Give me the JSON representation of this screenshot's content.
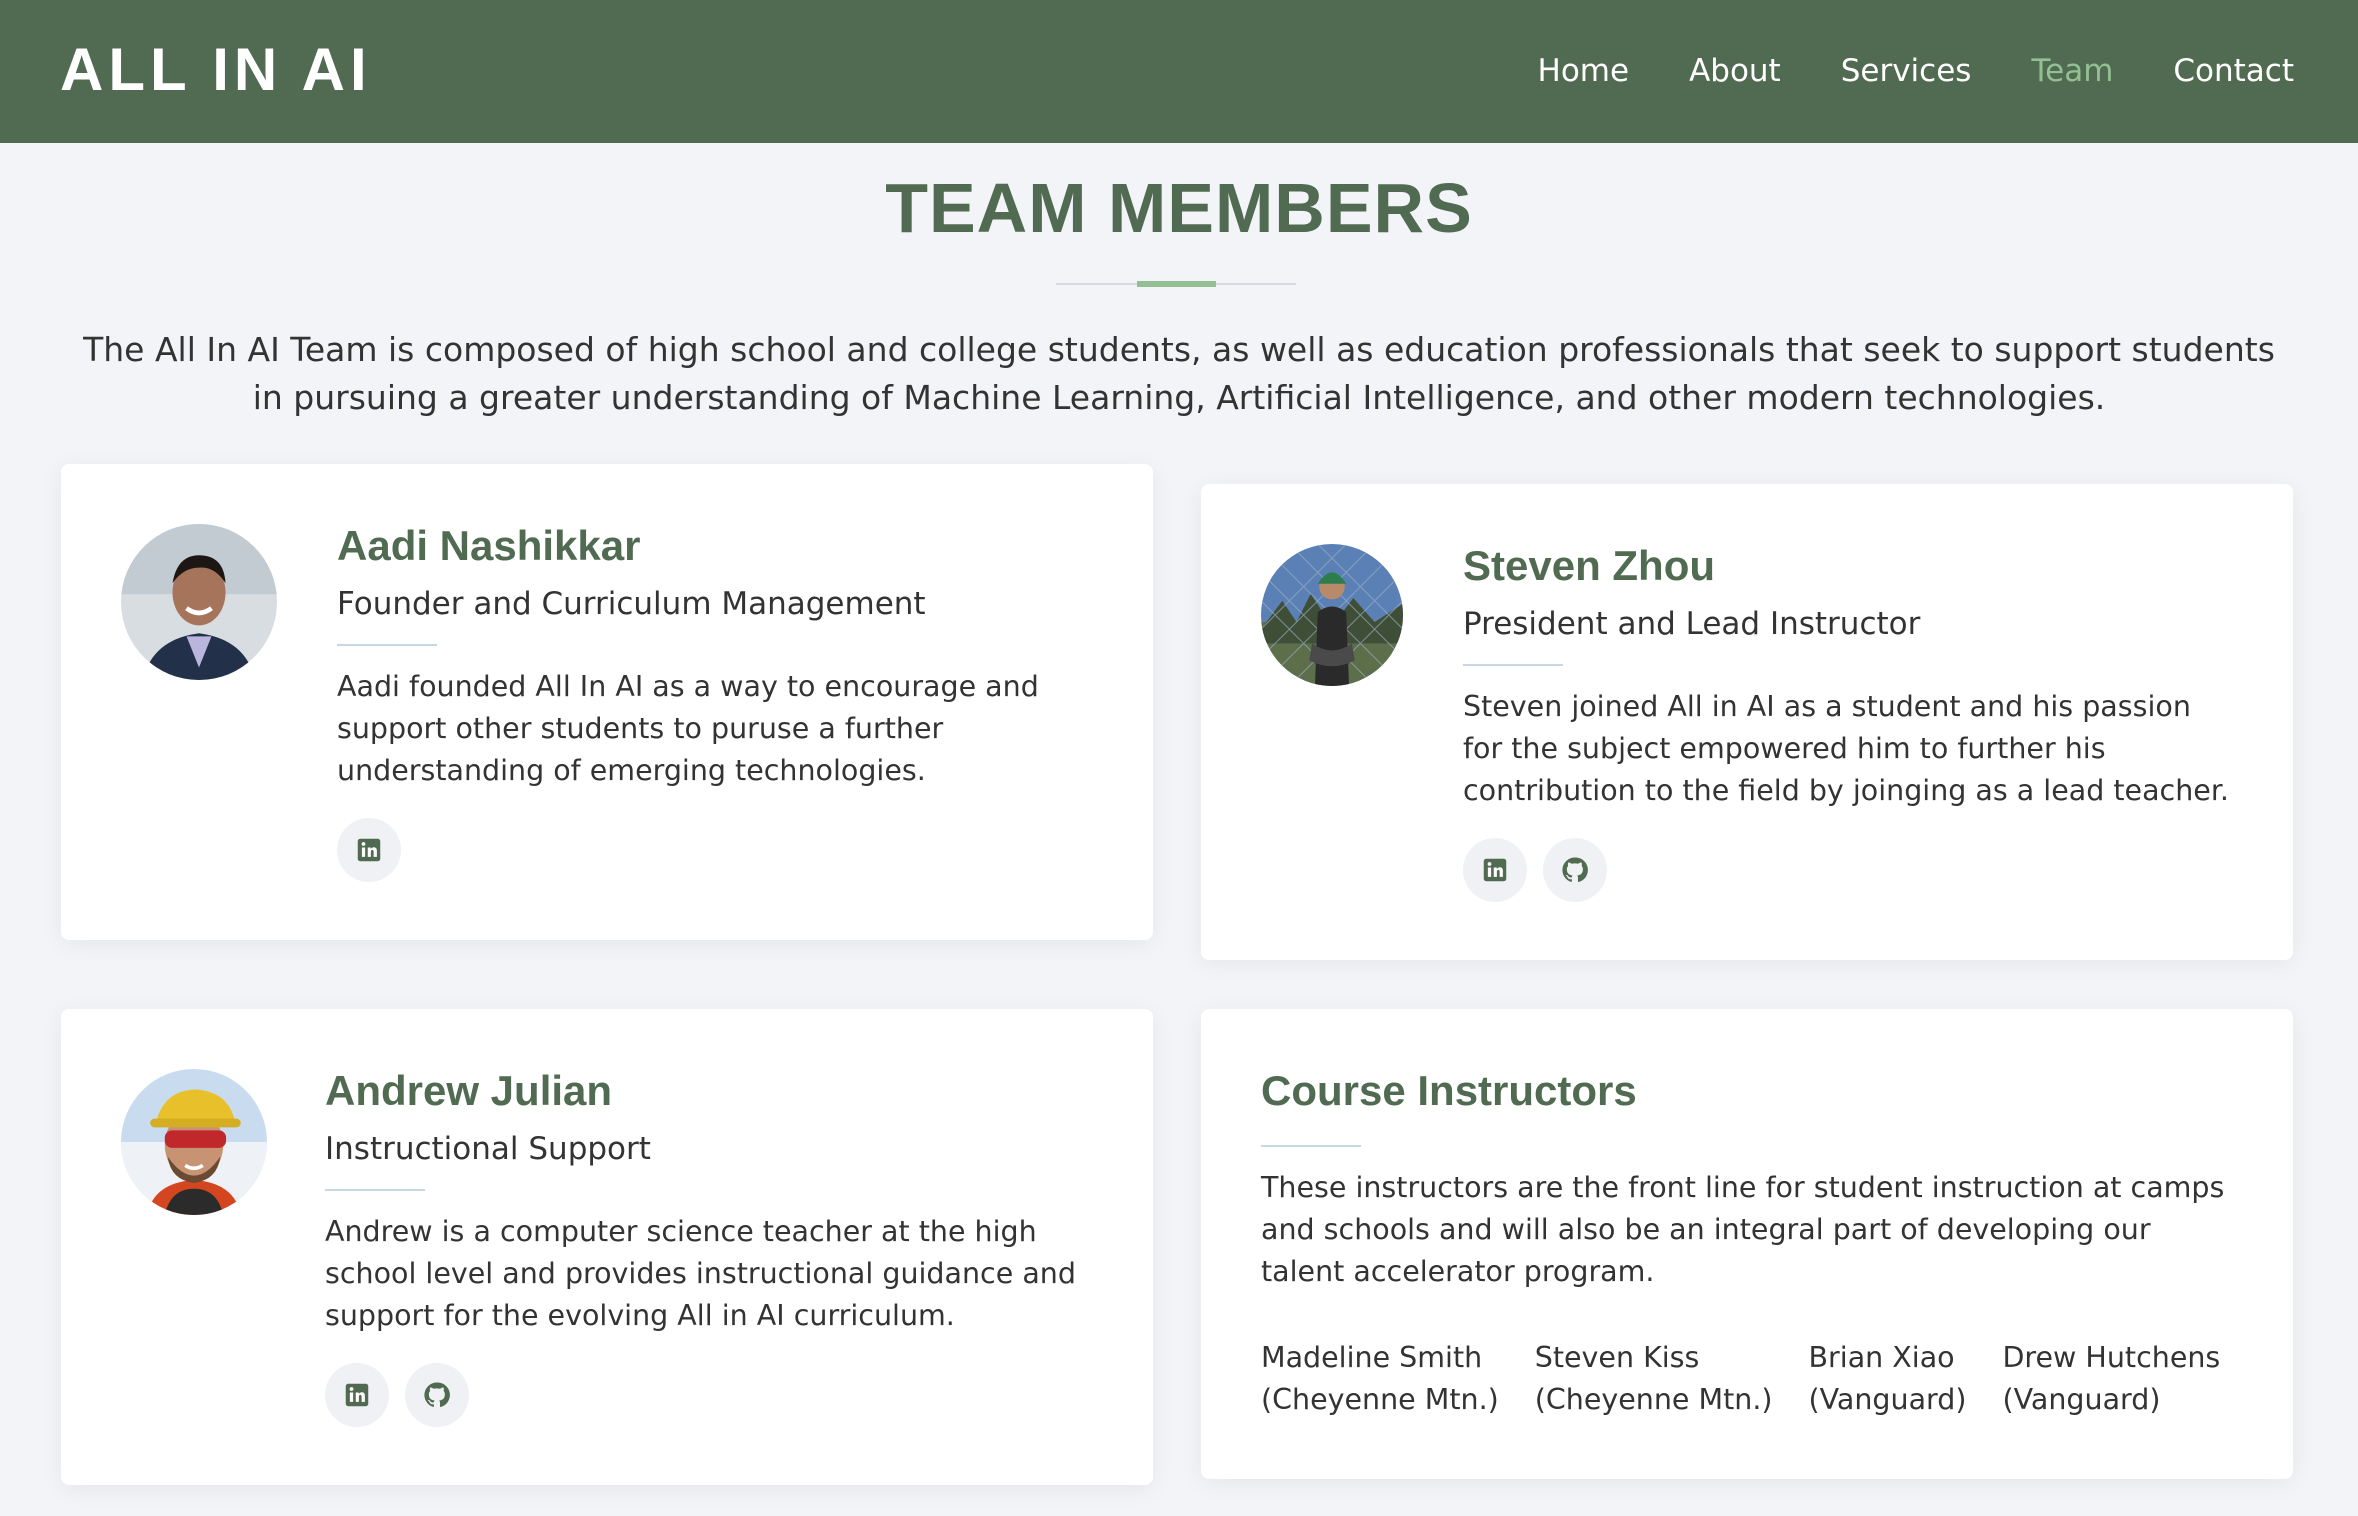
{
  "header": {
    "logo": "ALL IN AI",
    "nav": [
      "Home",
      "About",
      "Services",
      "Team",
      "Contact"
    ],
    "active": "Team"
  },
  "section": {
    "title": "TEAM MEMBERS",
    "intro": "The All In AI Team is composed of high school and college students, as well as education professionals that seek to support students in pursuing a greater understanding of Machine Learning, Artificial Intelligence, and other modern technologies."
  },
  "members": [
    {
      "name": "Aadi Nashikkar",
      "role": "Founder and Curriculum Management",
      "bio": "Aadi founded All In AI as a way to encourage and support other students to puruse a further understanding of emerging technologies.",
      "socials": [
        "linkedin-icon"
      ]
    },
    {
      "name": "Steven Zhou",
      "role": "President and Lead Instructor",
      "bio": "Steven joined All in AI as a student and his passion for the subject empowered him to further his contribution to the field by joinging as a lead teacher.",
      "socials": [
        "linkedin-icon",
        "github-icon"
      ]
    },
    {
      "name": "Andrew Julian",
      "role": "Instructional Support",
      "bio": "Andrew is a computer science teacher at the high school level and provides instructional guidance and support for the evolving All in AI curriculum.",
      "socials": [
        "linkedin-icon",
        "github-icon"
      ]
    }
  ],
  "instructors": {
    "title": "Course Instructors",
    "desc": "These instructors are the front line for student instruction at camps and schools and will also be an integral part of developing our talent accelerator program.",
    "people": [
      {
        "name": "Madeline Smith",
        "org": "(Cheyenne Mtn.)"
      },
      {
        "name": "Steven Kiss",
        "org": "(Cheyenne Mtn.)"
      },
      {
        "name": "Brian Xiao",
        "org": "(Vanguard)"
      },
      {
        "name": "Drew Hutchens",
        "org": "(Vanguard)"
      }
    ]
  },
  "colors": {
    "brand": "#506b51",
    "accent": "#93bf92",
    "background": "#f3f4f8"
  }
}
